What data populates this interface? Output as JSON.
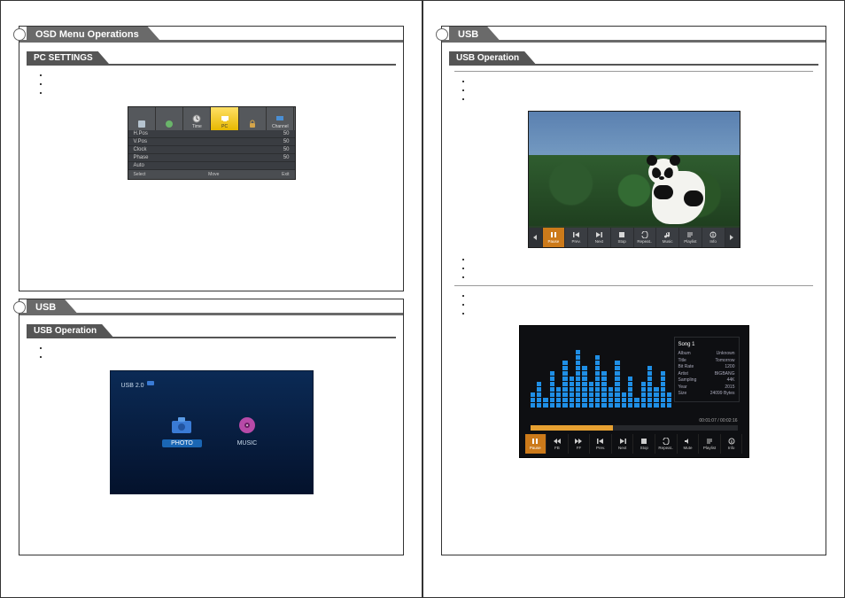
{
  "left": {
    "section1": {
      "header": "OSD Menu Operations",
      "subheader": "PC SETTINGS",
      "osd": {
        "icons": [
          "",
          "",
          "Time",
          "PC",
          "",
          "Channel"
        ],
        "hl_index": 3,
        "rows": [
          {
            "k": "H.Pos",
            "v": "50"
          },
          {
            "k": "V.Pos",
            "v": "50"
          },
          {
            "k": "Clock",
            "v": "50"
          },
          {
            "k": "Phase",
            "v": "50"
          },
          {
            "k": "Auto",
            "v": ""
          }
        ],
        "footer": [
          "Select",
          "Move",
          "Exit"
        ]
      }
    },
    "section2": {
      "header": "USB",
      "subheader": "USB Operation",
      "usb_title": "USB 2.0",
      "items": [
        {
          "label": "PHOTO",
          "sel": true
        },
        {
          "label": "MUSIC",
          "sel": false
        }
      ]
    }
  },
  "right": {
    "section": {
      "header": "USB",
      "subheader": "USB Operation",
      "photo_controls": [
        "Pause",
        "Prev.",
        "Next",
        "Stop",
        "Repeat..",
        "Music",
        "Playlist",
        "Info"
      ],
      "photo_hl": 0,
      "music_info": {
        "title": "Song 1",
        "rows": [
          {
            "k": "Album",
            "v": "Unknown"
          },
          {
            "k": "Title",
            "v": "Tomorrow"
          },
          {
            "k": "Bit Rate",
            "v": "1200"
          },
          {
            "k": "Artist",
            "v": "BIGBANG"
          },
          {
            "k": "Sampling",
            "v": "44K"
          },
          {
            "k": "Year",
            "v": "2015"
          },
          {
            "k": "Size",
            "v": "24099 Bytes"
          }
        ]
      },
      "music_time": "00:01:07 / 00:02:16",
      "music_controls": [
        "Pause",
        "FB",
        "FF",
        "Prev.",
        "Next",
        "Stop",
        "Repeat..",
        "Mute",
        "Playlist",
        "Info"
      ],
      "music_hl": 0,
      "viz_heights": [
        3,
        5,
        2,
        7,
        4,
        9,
        6,
        11,
        8,
        5,
        10,
        7,
        4,
        9,
        3,
        6,
        2,
        5,
        8,
        4,
        7,
        3
      ]
    }
  }
}
